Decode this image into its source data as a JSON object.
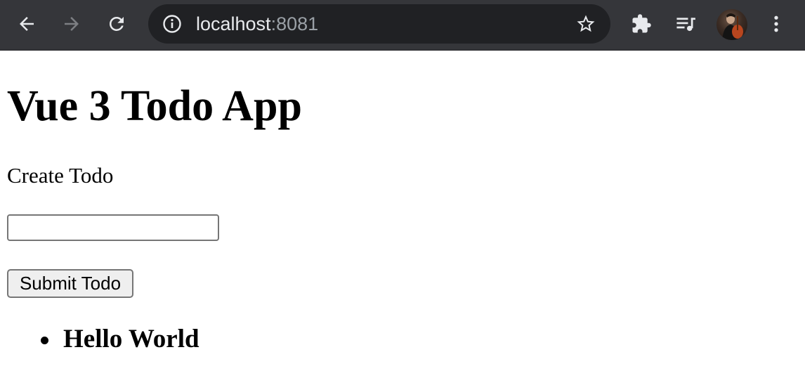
{
  "browser": {
    "url_host": "localhost",
    "url_port": ":8081",
    "icons": {
      "back": "arrow-left-icon",
      "forward": "arrow-right-icon",
      "reload": "reload-icon",
      "site_info": "info-icon",
      "bookmark": "star-icon",
      "extensions": "puzzle-icon",
      "media": "media-queue-icon",
      "profile": "avatar",
      "menu": "kebab-menu-icon"
    },
    "colors": {
      "toolbar_bg": "#35363a",
      "omnibox_bg": "#202124",
      "icon_active": "#e8eaed",
      "icon_disabled": "#7d7f83"
    }
  },
  "page": {
    "title": "Vue 3 Todo App",
    "create_label": "Create Todo",
    "input_value": "",
    "submit_label": "Submit Todo",
    "todos": [
      {
        "text": "Hello World"
      }
    ]
  }
}
